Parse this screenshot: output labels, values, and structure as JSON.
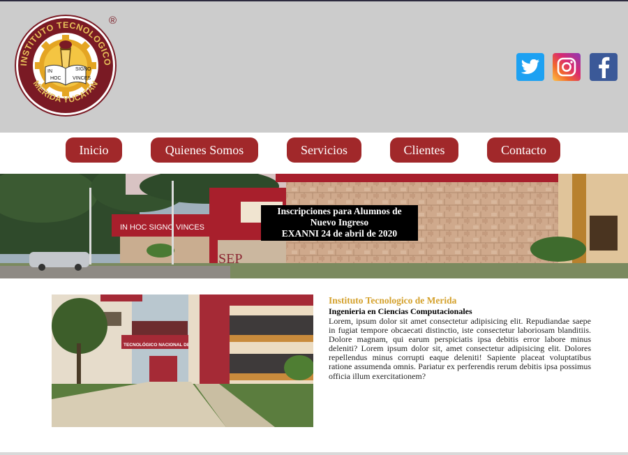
{
  "header": {
    "logo": {
      "top_text": "INSTITUTO TECNOLOGICO",
      "bottom_text": "MERIDA YUCATAN",
      "motto_words": [
        "IN",
        "SIGNO",
        "HOC",
        "VINCES"
      ],
      "registered_mark": "®"
    },
    "social": [
      {
        "name": "Twitter",
        "icon": "twitter-icon",
        "color": "#1da1f2"
      },
      {
        "name": "Instagram",
        "icon": "instagram-icon",
        "color": "#d92a6f"
      },
      {
        "name": "Facebook",
        "icon": "facebook-icon",
        "color": "#3b5998"
      }
    ]
  },
  "nav": {
    "items": [
      {
        "label": "Inicio"
      },
      {
        "label": "Quienes Somos"
      },
      {
        "label": "Servicios"
      },
      {
        "label": "Clientes"
      },
      {
        "label": "Contacto"
      }
    ],
    "button_color": "#a1282a"
  },
  "banner": {
    "notice_lines": [
      "Inscripciones para Alumnos de",
      "Nuevo Ingreso",
      "EXANNI 24 de abril de 2020"
    ],
    "sign_text": "IN HOC SIGNO VINCES",
    "sep_text": "SEP"
  },
  "content": {
    "photo_sign": "TECNOLÓGICO NACIONAL DE MÉXICO",
    "title": "Instituto Tecnologico de Merida",
    "subtitle": "Ingenieria en Ciencias Computacionales",
    "body": "Lorem, ipsum dolor sit amet consectetur adipisicing elit. Repudiandae saepe in fugiat tempore obcaecati distinctio, iste consectetur laboriosam blanditiis. Dolore magnam, qui earum perspiciatis ipsa debitis error labore minus deleniti? Lorem ipsum dolor sit, amet consectetur adipisicing elit. Dolores repellendus minus corrupti eaque deleniti! Sapiente placeat voluptatibus ratione assumenda omnis. Pariatur ex perferendis rerum debitis ipsa possimus officia illum exercitationem?"
  },
  "colors": {
    "header_bg": "#cccccc",
    "accent": "#a1282a",
    "title_gold": "#d4a12c"
  }
}
